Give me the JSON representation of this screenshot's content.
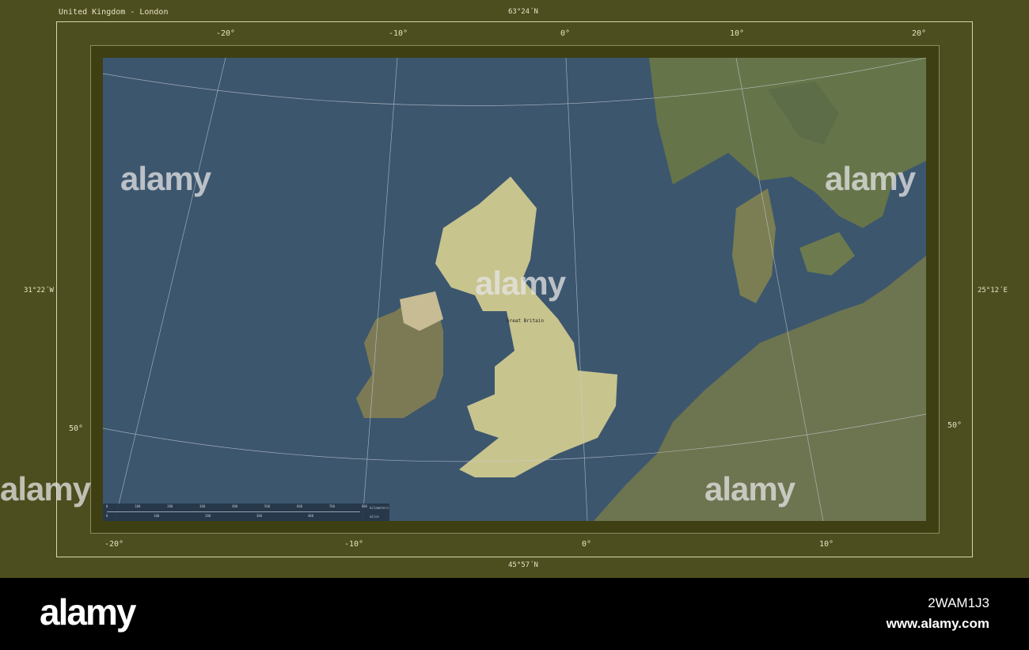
{
  "title": "United Kingdom - London",
  "frame": {
    "top_lat": "63°24´N",
    "bottom_lat": "45°57´N",
    "left_lon": "31°22´W",
    "right_lon": "25°12´E"
  },
  "ticks": {
    "top": [
      "-20°",
      "-10°",
      "0°",
      "10°",
      "20°"
    ],
    "bottom": [
      "-20°",
      "-10°",
      "0°",
      "10°"
    ],
    "left": [
      "50°"
    ],
    "right": [
      "50°"
    ]
  },
  "map_labels": {
    "great_britain": "Great Britain"
  },
  "scale": {
    "km": [
      "0",
      "100",
      "200",
      "300",
      "400",
      "500",
      "600",
      "700",
      "800"
    ],
    "km_unit": "kilometers",
    "mi": [
      "0",
      "100",
      "200",
      "300",
      "400"
    ],
    "mi_unit": "miles"
  },
  "watermark": {
    "brand": "alamy",
    "image_id": "2WAM1J3",
    "url": "www.alamy.com"
  },
  "colors": {
    "frame": "#4d4e1f",
    "band": "#3e3f12",
    "sea": "#3c566e",
    "land": "#6f7a48",
    "uk": "#c8c48e"
  }
}
